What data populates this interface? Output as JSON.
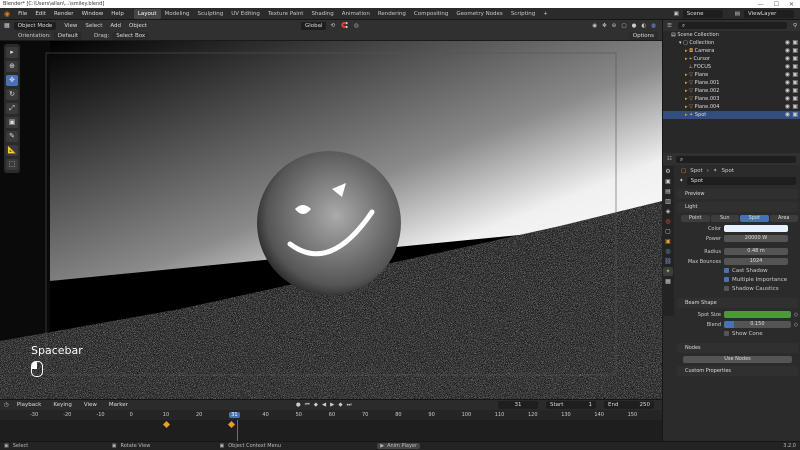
{
  "window": {
    "title": "Blender* [C:\\Users\\allan\\...\\smiley.blend]",
    "controls": [
      "—",
      "☐",
      "✕"
    ]
  },
  "menu": [
    "File",
    "Edit",
    "Render",
    "Window",
    "Help"
  ],
  "workspaces": [
    "Layout",
    "Modeling",
    "Sculpting",
    "UV Editing",
    "Texture Paint",
    "Shading",
    "Animation",
    "Rendering",
    "Compositing",
    "Geometry Nodes",
    "Scripting"
  ],
  "active_workspace": "Layout",
  "scene": {
    "label": "Scene",
    "view_layer": "ViewLayer"
  },
  "viewport_header": {
    "mode": "Object Mode",
    "menus": [
      "View",
      "Select",
      "Add",
      "Object"
    ],
    "transform": "Global",
    "orientation_label": "Orientation:",
    "orientation_value": "Default",
    "drag_label": "Drag:",
    "drag_value": "Select Box",
    "options": "Options"
  },
  "overlay_text": "Spacebar",
  "timeline": {
    "menus": [
      "Playback",
      "Keying",
      "View",
      "Marker"
    ],
    "current_frame": "31",
    "start_label": "Start",
    "start": "1",
    "end_label": "End",
    "end": "250",
    "ruler": [
      "-30",
      "-20",
      "-10",
      "0",
      "10",
      "20",
      "31",
      "40",
      "50",
      "60",
      "70",
      "80",
      "90",
      "100",
      "110",
      "120",
      "130",
      "140",
      "150"
    ]
  },
  "statusbar": {
    "select": "Select",
    "rotate": "Rotate View",
    "context": "Object Context Menu",
    "anim": "Anim Player",
    "version": "3.2.0"
  },
  "outliner": {
    "root": "Scene Collection",
    "collection": "Collection",
    "items": [
      "Camera",
      "Cursor",
      "FOCUS",
      "Plane",
      "Plane.001",
      "Plane.002",
      "Plane.003",
      "Plane.004",
      "Spot"
    ],
    "selected": "Spot"
  },
  "properties": {
    "breadcrumb_obj": "Spot",
    "breadcrumb_data": "Spot",
    "data_name": "Spot",
    "sections": {
      "preview": "Preview",
      "light": "Light",
      "beam": "Beam Shape",
      "nodes": "Nodes",
      "custom": "Custom Properties"
    },
    "light_types": [
      "Point",
      "Sun",
      "Spot",
      "Area"
    ],
    "active_light_type": "Spot",
    "color_label": "Color",
    "power_label": "Power",
    "power": "20000 W",
    "radius_label": "Radius",
    "radius": "0.48 m",
    "max_bounces_label": "Max Bounces",
    "max_bounces": "1024",
    "checks": [
      {
        "label": "Cast Shadow",
        "on": true
      },
      {
        "label": "Multiple Importance",
        "on": true
      },
      {
        "label": "Shadow Caustics",
        "on": false
      }
    ],
    "spot_size_label": "Spot Size",
    "spot_size": "",
    "blend_label": "Blend",
    "blend": "0.150",
    "blend_fraction": 0.15,
    "show_cone": "Show Cone",
    "use_nodes": "Use Nodes"
  },
  "colors": {
    "accent": "#4772b3",
    "spot_size_bar": "#4a9a3a",
    "keyframe": "#e8a020",
    "playhead": "#4772b3"
  }
}
